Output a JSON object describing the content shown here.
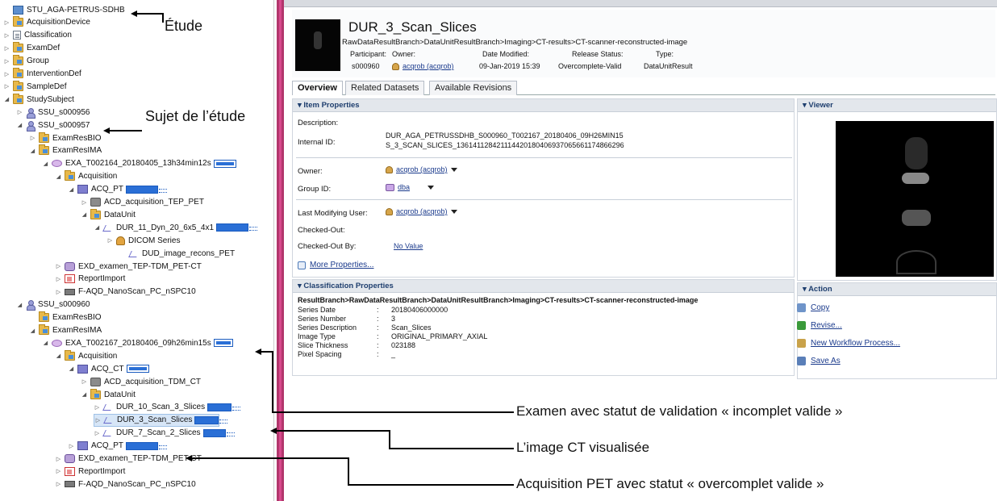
{
  "tree": [
    {
      "label": "STU_AGA-PETRUS-SDHB",
      "icon": "study-icon",
      "level": 0,
      "exp": ""
    },
    {
      "label": "AcquisitionDevice",
      "icon": "folder-icon",
      "level": 0,
      "exp": "▷"
    },
    {
      "label": "Classification",
      "icon": "document-icon",
      "level": 0,
      "exp": "▷"
    },
    {
      "label": "ExamDef",
      "icon": "folder-icon",
      "level": 0,
      "exp": "▷"
    },
    {
      "label": "Group",
      "icon": "folder-icon",
      "level": 0,
      "exp": "▷"
    },
    {
      "label": "InterventionDef",
      "icon": "folder-icon",
      "level": 0,
      "exp": "▷"
    },
    {
      "label": "SampleDef",
      "icon": "folder-icon",
      "level": 0,
      "exp": "▷"
    },
    {
      "label": "StudySubject",
      "icon": "folder-icon",
      "level": 0,
      "exp": "◢"
    },
    {
      "label": "SSU_s000956",
      "icon": "person-icon",
      "level": 1,
      "exp": "▷"
    },
    {
      "label": "SSU_s000957",
      "icon": "person-icon",
      "level": 1,
      "exp": "◢"
    },
    {
      "label": "ExamResBIO",
      "icon": "folder-icon",
      "level": 2,
      "exp": "▷"
    },
    {
      "label": "ExamResIMA",
      "icon": "folder-icon",
      "level": 2,
      "exp": "◢"
    },
    {
      "label": "EXA_T002164_20180405_13h34min12s",
      "icon": "exam-icon",
      "level": 3,
      "exp": "◢",
      "bar": "hollow"
    },
    {
      "label": "Acquisition",
      "icon": "folder-icon",
      "level": 4,
      "exp": "◢"
    },
    {
      "label": "ACQ_PT",
      "icon": "acquisition-icon",
      "level": 5,
      "exp": "◢",
      "bar": "solid"
    },
    {
      "label": "ACD_acquisition_TEP_PET",
      "icon": "device-icon",
      "level": 6,
      "exp": "▷"
    },
    {
      "label": "DataUnit",
      "icon": "folder-icon",
      "level": 6,
      "exp": "◢"
    },
    {
      "label": "DUR_11_Dyn_20_6x5_4x1",
      "icon": "data-unit-icon",
      "level": 7,
      "exp": "◢",
      "bar": "solid"
    },
    {
      "label": "DICOM Series",
      "icon": "dicom-icon",
      "level": 8,
      "exp": "▷"
    },
    {
      "label": "DUD_image_recons_PET",
      "icon": "data-unit-icon",
      "level": 9,
      "exp": ""
    },
    {
      "label": "EXD_examen_TEP-TDM_PET-CT",
      "icon": "exam-def-icon",
      "level": 4,
      "exp": "▷"
    },
    {
      "label": "ReportImport",
      "icon": "report-icon",
      "level": 4,
      "exp": "▷"
    },
    {
      "label": "F-AQD_NanoScan_PC_nSPC10",
      "icon": "monitor-icon",
      "level": 4,
      "exp": "▷"
    },
    {
      "label": "SSU_s000960",
      "icon": "person-icon",
      "level": 1,
      "exp": "◢"
    },
    {
      "label": "ExamResBIO",
      "icon": "folder-icon",
      "level": 2,
      "exp": ""
    },
    {
      "label": "ExamResIMA",
      "icon": "folder-icon",
      "level": 2,
      "exp": "◢"
    },
    {
      "label": "EXA_T002167_20180406_09h26min15s",
      "icon": "exam-icon",
      "level": 3,
      "exp": "◢",
      "bar": "hollow"
    },
    {
      "label": "Acquisition",
      "icon": "folder-icon",
      "level": 4,
      "exp": "◢"
    },
    {
      "label": "ACQ_CT",
      "icon": "acquisition-icon",
      "level": 5,
      "exp": "◢",
      "bar": "hollow"
    },
    {
      "label": "ACD_acquisition_TDM_CT",
      "icon": "device-icon",
      "level": 6,
      "exp": "▷"
    },
    {
      "label": "DataUnit",
      "icon": "folder-icon",
      "level": 6,
      "exp": "◢"
    },
    {
      "label": "DUR_10_Scan_3_Slices",
      "icon": "data-unit-icon",
      "level": 7,
      "exp": "▷",
      "bar": "solid"
    },
    {
      "label": "DUR_3_Scan_Slices",
      "icon": "data-unit-icon",
      "level": 7,
      "exp": "▷",
      "bar": "solid",
      "selected": true
    },
    {
      "label": "DUR_7_Scan_2_Slices",
      "icon": "data-unit-icon",
      "level": 7,
      "exp": "▷",
      "bar": "solid"
    },
    {
      "label": "ACQ_PT",
      "icon": "acquisition-icon",
      "level": 5,
      "exp": "▷",
      "bar": "solid"
    },
    {
      "label": "EXD_examen_TEP-TDM_PET-CT",
      "icon": "exam-def-icon",
      "level": 4,
      "exp": "▷"
    },
    {
      "label": "ReportImport",
      "icon": "report-icon",
      "level": 4,
      "exp": "▷"
    },
    {
      "label": "F-AQD_NanoScan_PC_nSPC10",
      "icon": "monitor-icon",
      "level": 4,
      "exp": "▷"
    }
  ],
  "annotations": {
    "etude": "Étude",
    "sujet": "Sujet de l’étude",
    "examen": "Examen avec statut de validation « incomplet valide »",
    "image_ct": "L’image CT visualisée",
    "acq_pet": "Acquisition PET avec statut « overcomplet valide »"
  },
  "header": {
    "title": "DUR_3_Scan_Slices",
    "path": "RawDataResultBranch>DataUnitResultBranch>Imaging>CT-results>CT-scanner-reconstructed-image",
    "participant_label": "Participant:",
    "owner_label": "Owner:",
    "date_label": "Date Modified:",
    "release_label": "Release Status:",
    "type_label": "Type:",
    "participant": "s000960",
    "owner": "acqrob (acqrob)",
    "date": "09-Jan-2019 15:39",
    "release": "Overcomplete-Valid",
    "type": "DataUnitResult"
  },
  "tabs": [
    "Overview",
    "Related Datasets",
    "Available Revisions"
  ],
  "item_properties": {
    "title": "Item Properties",
    "description_label": "Description:",
    "internal_id_label": "Internal ID:",
    "internal_id_line1": "DUR_AGA_PETRUSSDHB_S000960_T002167_20180406_09H26MIN15",
    "internal_id_line2": "S_3_SCAN_SLICES_1361411284211144201804069370656611748662​96",
    "owner_label": "Owner:",
    "owner": "acqrob (acqrob)",
    "group_label": "Group ID:",
    "group": "dba",
    "last_mod_label": "Last Modifying User:",
    "last_mod": "acqrob (acqrob)",
    "checked_out_label": "Checked-Out:",
    "checked_out_by_label": "Checked-Out By:",
    "checked_out_by": "No Value",
    "more": "More Properties..."
  },
  "classification": {
    "title": "Classification Properties",
    "path": "ResultBranch>RawDataResultBranch>DataUnitResultBranch>Imaging>CT-results>CT-scanner-reconstructed-image",
    "rows": [
      {
        "k": "Series Date",
        "v": "20180406000000"
      },
      {
        "k": "Series Number",
        "v": "3"
      },
      {
        "k": "Series Description",
        "v": "Scan_Slices"
      },
      {
        "k": "Image Type",
        "v": "ORIGINAL_PRIMARY_AXIAL"
      },
      {
        "k": "Slice Thickness",
        "v": "023188"
      },
      {
        "k": "Pixel Spacing",
        "v": "_"
      }
    ]
  },
  "viewer": {
    "title": "Viewer"
  },
  "action": {
    "title": "Action",
    "items": [
      {
        "label": "Copy",
        "icon": "copy-icon"
      },
      {
        "label": "Revise...",
        "icon": "revise-icon"
      },
      {
        "label": "New Workflow Process...",
        "icon": "workflow-icon"
      },
      {
        "label": "Save As",
        "icon": "save-icon"
      }
    ]
  },
  "colors": {
    "accent": "#b2366c",
    "status_bar": "#2a6fd6",
    "panel_header": "#e3e7ec"
  }
}
